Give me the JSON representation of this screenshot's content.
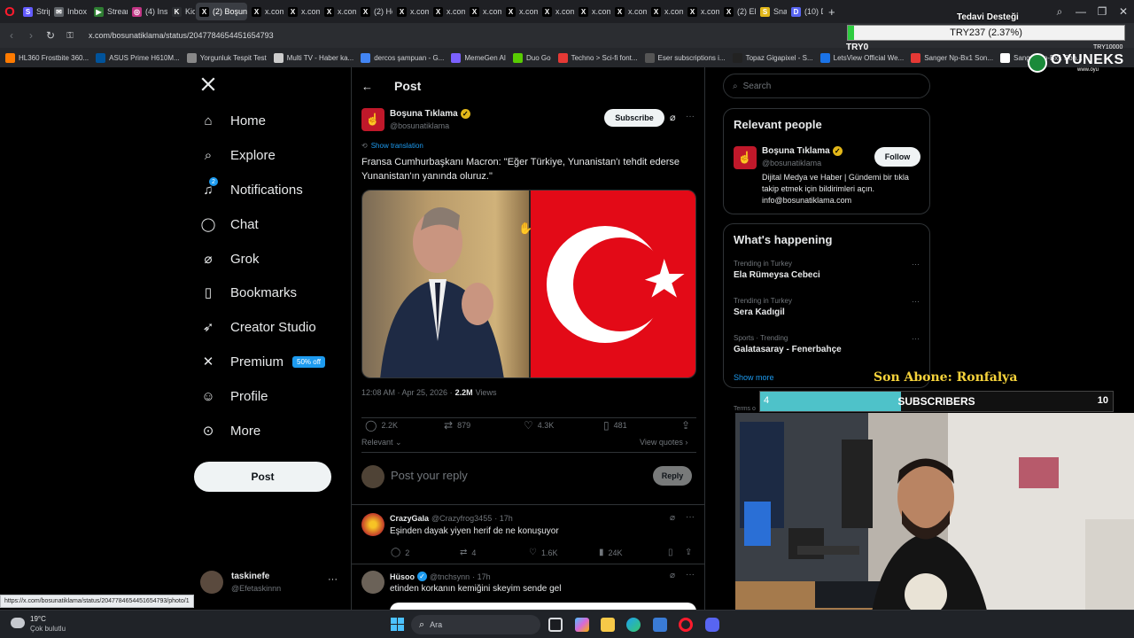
{
  "browser": {
    "tabs": [
      {
        "label": "Stripe",
        "favicon": "S",
        "color": "#635bff"
      },
      {
        "label": "Inbox",
        "favicon": "✉",
        "color": "#5f6368"
      },
      {
        "label": "Stream",
        "favicon": "▶",
        "color": "#2e7d32"
      },
      {
        "label": "(4) Ins",
        "favicon": "◎",
        "color": "#c13584"
      },
      {
        "label": "KickSt",
        "favicon": "K",
        "color": "#2b2d31"
      },
      {
        "label": "(2) Boşuna",
        "favicon": "X",
        "color": "#000000",
        "active": true
      },
      {
        "label": "x.com",
        "favicon": "X",
        "color": "#000000"
      },
      {
        "label": "x.com",
        "favicon": "X",
        "color": "#000000"
      },
      {
        "label": "x.com",
        "favicon": "X",
        "color": "#000000"
      },
      {
        "label": "(2) Ho",
        "favicon": "X",
        "color": "#000000"
      },
      {
        "label": "x.com",
        "favicon": "X",
        "color": "#000000"
      },
      {
        "label": "x.com",
        "favicon": "X",
        "color": "#000000"
      },
      {
        "label": "x.com",
        "favicon": "X",
        "color": "#000000"
      },
      {
        "label": "x.com",
        "favicon": "X",
        "color": "#000000"
      },
      {
        "label": "x.com",
        "favicon": "X",
        "color": "#000000"
      },
      {
        "label": "x.com",
        "favicon": "X",
        "color": "#000000"
      },
      {
        "label": "x.com",
        "favicon": "X",
        "color": "#000000"
      },
      {
        "label": "x.com",
        "favicon": "X",
        "color": "#000000"
      },
      {
        "label": "x.com",
        "favicon": "X",
        "color": "#000000"
      },
      {
        "label": "(2) Ele",
        "favicon": "X",
        "color": "#000000"
      },
      {
        "label": "Snatc",
        "favicon": "S",
        "color": "#e2b719"
      },
      {
        "label": "(10) D",
        "favicon": "D",
        "color": "#5865f2"
      }
    ],
    "new_tab": "+",
    "url": "x.com/bosunatiklama/status/2047784654451654793",
    "bookmarks": [
      {
        "label": "HL360 Frostbite 360...",
        "color": "#ff7b00"
      },
      {
        "label": "ASUS Prime H610M...",
        "color": "#00539b"
      },
      {
        "label": "Yorgunluk Tespit Test",
        "color": "#888888"
      },
      {
        "label": "Multi TV - Haber ka...",
        "color": "#cccccc"
      },
      {
        "label": "dercos şampuan - G...",
        "color": "#4285f4"
      },
      {
        "label": "MemeGen AI",
        "color": "#7b61ff"
      },
      {
        "label": "Duo Go",
        "color": "#58cc02"
      },
      {
        "label": "Techno > Sci-fi font...",
        "color": "#e53935"
      },
      {
        "label": "Eser subscriptions i...",
        "color": "#555555"
      },
      {
        "label": "Topaz Gigapixel - S...",
        "color": "#222222"
      },
      {
        "label": "LetsView Official We...",
        "color": "#1a73e8"
      },
      {
        "label": "Sanger Np-Bx1 Son...",
        "color": "#e53935"
      },
      {
        "label": "Sanger Np-Bx1 Son...",
        "color": "#ffffff"
      }
    ]
  },
  "stream_overlay": {
    "donation_title": "Tedavi Desteği",
    "ticker": "TRY237 (2.37%)",
    "ticker_left": "TRY0",
    "ticker_right": "TRY10000",
    "progress_fraction": 0.0237,
    "brand": "OYUNEKS",
    "brand_sub": "www.oyu",
    "last_sub_label": "Son Abone: Ronfalya",
    "sub_current": "4",
    "sub_label": "SUBSCRIBERS",
    "sub_goal": "10",
    "sub_fraction": 0.4
  },
  "sidebar": {
    "logo": "X",
    "items": [
      {
        "label": "Home",
        "icon": "home-icon"
      },
      {
        "label": "Explore",
        "icon": "search-icon"
      },
      {
        "label": "Notifications",
        "icon": "bell-icon",
        "badge": "2"
      },
      {
        "label": "Chat",
        "icon": "chat-icon"
      },
      {
        "label": "Grok",
        "icon": "grok-icon"
      },
      {
        "label": "Bookmarks",
        "icon": "bookmark-icon"
      },
      {
        "label": "Creator Studio",
        "icon": "rocket-icon"
      },
      {
        "label": "Premium",
        "icon": "x-icon",
        "badge_text": "50% off"
      },
      {
        "label": "Profile",
        "icon": "person-icon"
      },
      {
        "label": "More",
        "icon": "more-icon"
      }
    ],
    "post_button": "Post",
    "account": {
      "name": "taskinefe",
      "handle": "@Efetaskinnn"
    }
  },
  "status_url": "https://x.com/bosunatiklama/status/2047784654451654793/photo/1",
  "post": {
    "header_title": "Post",
    "author_name": "Boşuna Tıklama",
    "author_handle": "@bosunatiklama",
    "subscribe_label": "Subscribe",
    "show_translation": "Show translation",
    "text": "Fransa Cumhurbaşkanı Macron: \"Eğer Türkiye, Yunanistan'ı tehdit ederse Yunanistan'ın yanında oluruz.\"",
    "time": "12:08 AM · Apr 25, 2026 ·",
    "views_count": "2.2M",
    "views_label": "Views",
    "replies": "2.2K",
    "reposts": "879",
    "likes": "4.3K",
    "bookmarks": "481",
    "relevant_label": "Relevant",
    "view_quotes": "View quotes",
    "reply_placeholder": "Post your reply",
    "reply_button": "Reply"
  },
  "replies": [
    {
      "name": "CrazyGala",
      "handle": "@Crazyfrog3455",
      "time": "· 17h",
      "text": "Eşinden dayak yiyen herif de ne konuşuyor",
      "replies": "2",
      "reposts": "4",
      "likes": "1.6K",
      "views": "24K",
      "verified": false
    },
    {
      "name": "Hüsoo",
      "handle": "@tnchsynn",
      "time": "· 17h",
      "text": "etinden korkanın kemiğini skeyim sende gel",
      "verified": true
    }
  ],
  "right": {
    "search_placeholder": "Search",
    "relevant_title": "Relevant people",
    "person_name": "Boşuna Tıklama",
    "person_handle": "@bosunatiklama",
    "follow_label": "Follow",
    "person_bio": "Dijital Medya ve Haber | Gündemi bir tıkla takip etmek için bildirimleri açın. info@bosunatiklama.com",
    "happening_title": "What's happening",
    "trends": [
      {
        "category": "Trending in Turkey",
        "name": "Ela Rümeysa Cebeci"
      },
      {
        "category": "Trending in Turkey",
        "name": "Sera Kadıgil"
      },
      {
        "category": "Sports · Trending",
        "name": "Galatasaray - Fenerbahçe"
      }
    ],
    "show_more": "Show more",
    "terms_fragment": "Terms o"
  },
  "taskbar": {
    "temperature": "19°C",
    "weather": "Çok bulutlu",
    "search_placeholder": "Ara"
  }
}
